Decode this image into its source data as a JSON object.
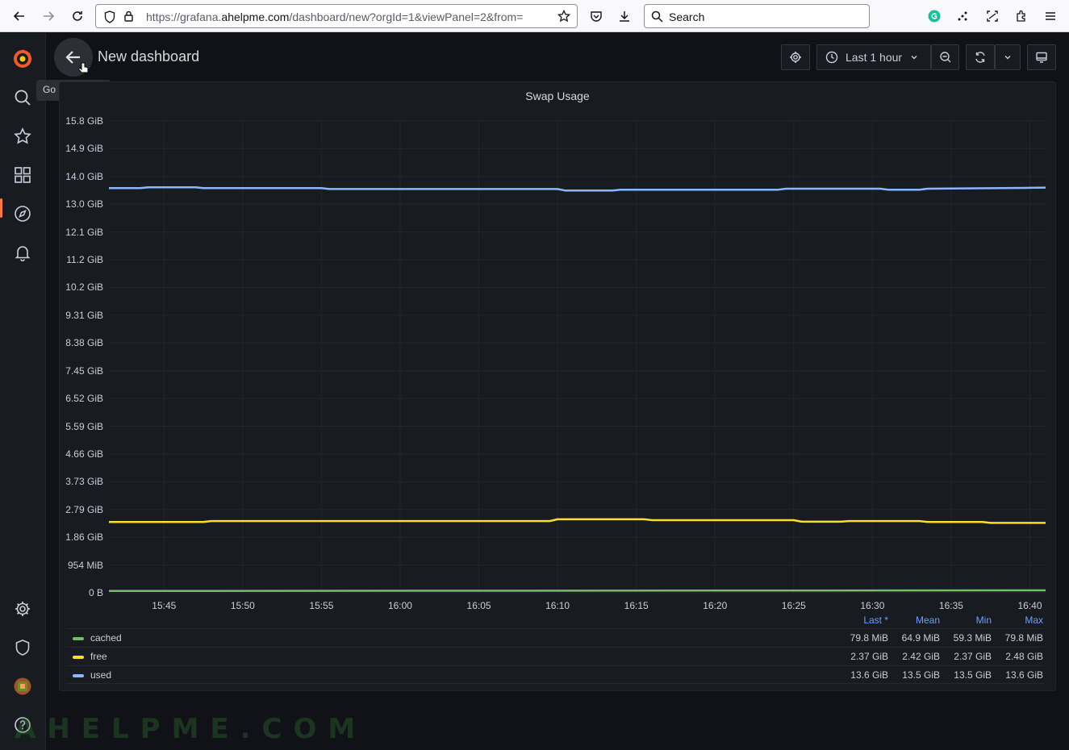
{
  "browser": {
    "url_prefix": "https://grafana.",
    "url_domain": "ahelpme.com",
    "url_suffix": "/dashboard/new?orgId=1&viewPanel=2&from=",
    "search_placeholder": "Search"
  },
  "header": {
    "title": "New dashboard",
    "tooltip": "Go back (Esc)",
    "time_range": "Last 1 hour"
  },
  "panel": {
    "title": "Swap Usage"
  },
  "legend": {
    "headers": [
      "Last *",
      "Mean",
      "Min",
      "Max"
    ],
    "rows": [
      {
        "name": "cached",
        "color": "#73bf69",
        "last": "79.8 MiB",
        "mean": "64.9 MiB",
        "min": "59.3 MiB",
        "max": "79.8 MiB"
      },
      {
        "name": "free",
        "color": "#fade2a",
        "last": "2.37 GiB",
        "mean": "2.42 GiB",
        "min": "2.37 GiB",
        "max": "2.48 GiB"
      },
      {
        "name": "used",
        "color": "#8ab8ff",
        "last": "13.6 GiB",
        "mean": "13.5 GiB",
        "min": "13.5 GiB",
        "max": "13.6 GiB"
      }
    ]
  },
  "chart_data": {
    "type": "line",
    "title": "Swap Usage",
    "y_ticks": [
      "15.8 GiB",
      "14.9 GiB",
      "14.0 GiB",
      "13.0 GiB",
      "12.1 GiB",
      "11.2 GiB",
      "10.2 GiB",
      "9.31 GiB",
      "8.38 GiB",
      "7.45 GiB",
      "6.52 GiB",
      "5.59 GiB",
      "4.66 GiB",
      "3.73 GiB",
      "2.79 GiB",
      "1.86 GiB",
      "954 MiB",
      "0 B"
    ],
    "ylim_gib": [
      0,
      15.8
    ],
    "x_ticks": [
      "15:45",
      "15:50",
      "15:55",
      "16:00",
      "16:05",
      "16:10",
      "16:15",
      "16:20",
      "16:25",
      "16:30",
      "16:35",
      "16:40"
    ],
    "x_minutes": [
      45,
      50,
      55,
      60,
      65,
      70,
      75,
      80,
      85,
      90,
      95,
      100
    ],
    "xlim_minutes": [
      41.5,
      101
    ],
    "grid": true,
    "series": [
      {
        "name": "used",
        "color": "#8ab8ff",
        "x": [
          41.5,
          43.5,
          44,
          47,
          47.5,
          55,
          55.5,
          67,
          70,
          70.5,
          73.5,
          74,
          84,
          84.5,
          90.5,
          91,
          93,
          93.5,
          100,
          101
        ],
        "y": [
          13.55,
          13.55,
          13.58,
          13.58,
          13.55,
          13.55,
          13.52,
          13.52,
          13.52,
          13.47,
          13.47,
          13.5,
          13.5,
          13.53,
          13.53,
          13.5,
          13.5,
          13.53,
          13.56,
          13.57
        ]
      },
      {
        "name": "free",
        "color": "#fade2a",
        "x": [
          41.5,
          47.5,
          48,
          69.5,
          70,
          75.5,
          76,
          85,
          85.5,
          88,
          88.5,
          93,
          93.5,
          97,
          97.5,
          101
        ],
        "y": [
          2.37,
          2.37,
          2.4,
          2.4,
          2.46,
          2.46,
          2.43,
          2.43,
          2.38,
          2.38,
          2.4,
          2.4,
          2.37,
          2.37,
          2.34,
          2.34
        ]
      },
      {
        "name": "cached",
        "color": "#73bf69",
        "x": [
          41.5,
          101
        ],
        "y": [
          0.06,
          0.08
        ]
      }
    ]
  }
}
